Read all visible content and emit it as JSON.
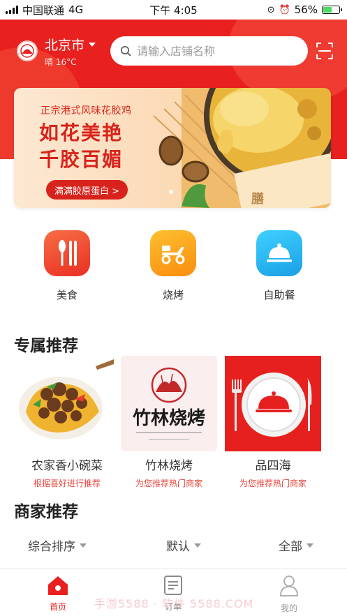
{
  "status_bar": {
    "carrier": "中国联通",
    "network": "4G",
    "time": "下午 4:05",
    "battery_percent": "56%",
    "battery_level": 0.56
  },
  "header": {
    "city": "北京市",
    "weather": "晴 16°C",
    "search_placeholder": "请输入店铺名称",
    "brand_color": "#e8201f"
  },
  "banner": {
    "subtitle": "正宗港式风味花胶鸡",
    "title_line1": "如花美艳",
    "title_line2": "千胶百媚",
    "cta": "满满胶原蛋白 >",
    "art_text": "膳"
  },
  "categories": [
    {
      "label": "美食",
      "icon": "utensils-icon",
      "color": "#f24a31"
    },
    {
      "label": "烧烤",
      "icon": "scooter-icon",
      "color": "#fca41c"
    },
    {
      "label": "自助餐",
      "icon": "dish-cloche-icon",
      "color": "#28b9f0"
    }
  ],
  "exclusive": {
    "title": "专属推荐",
    "items": [
      {
        "name": "农家香小碗菜",
        "desc": "根据喜好进行推荐"
      },
      {
        "name": "竹林烧烤",
        "desc": "为您推荐热门商家",
        "logo_text": "竹林烧烤"
      },
      {
        "name": "品四海",
        "desc": "为您推荐热门商家"
      }
    ]
  },
  "merchants": {
    "title": "商家推荐",
    "filters": [
      "综合排序",
      "默认",
      "全部"
    ]
  },
  "tabbar": {
    "tabs": [
      {
        "label": "首页",
        "icon": "home-icon",
        "active": true
      },
      {
        "label": "订单",
        "icon": "order-icon",
        "active": false
      },
      {
        "label": "我的",
        "icon": "profile-icon",
        "active": false
      }
    ],
    "watermark": "手游5588 · 软件 5588.COM"
  }
}
